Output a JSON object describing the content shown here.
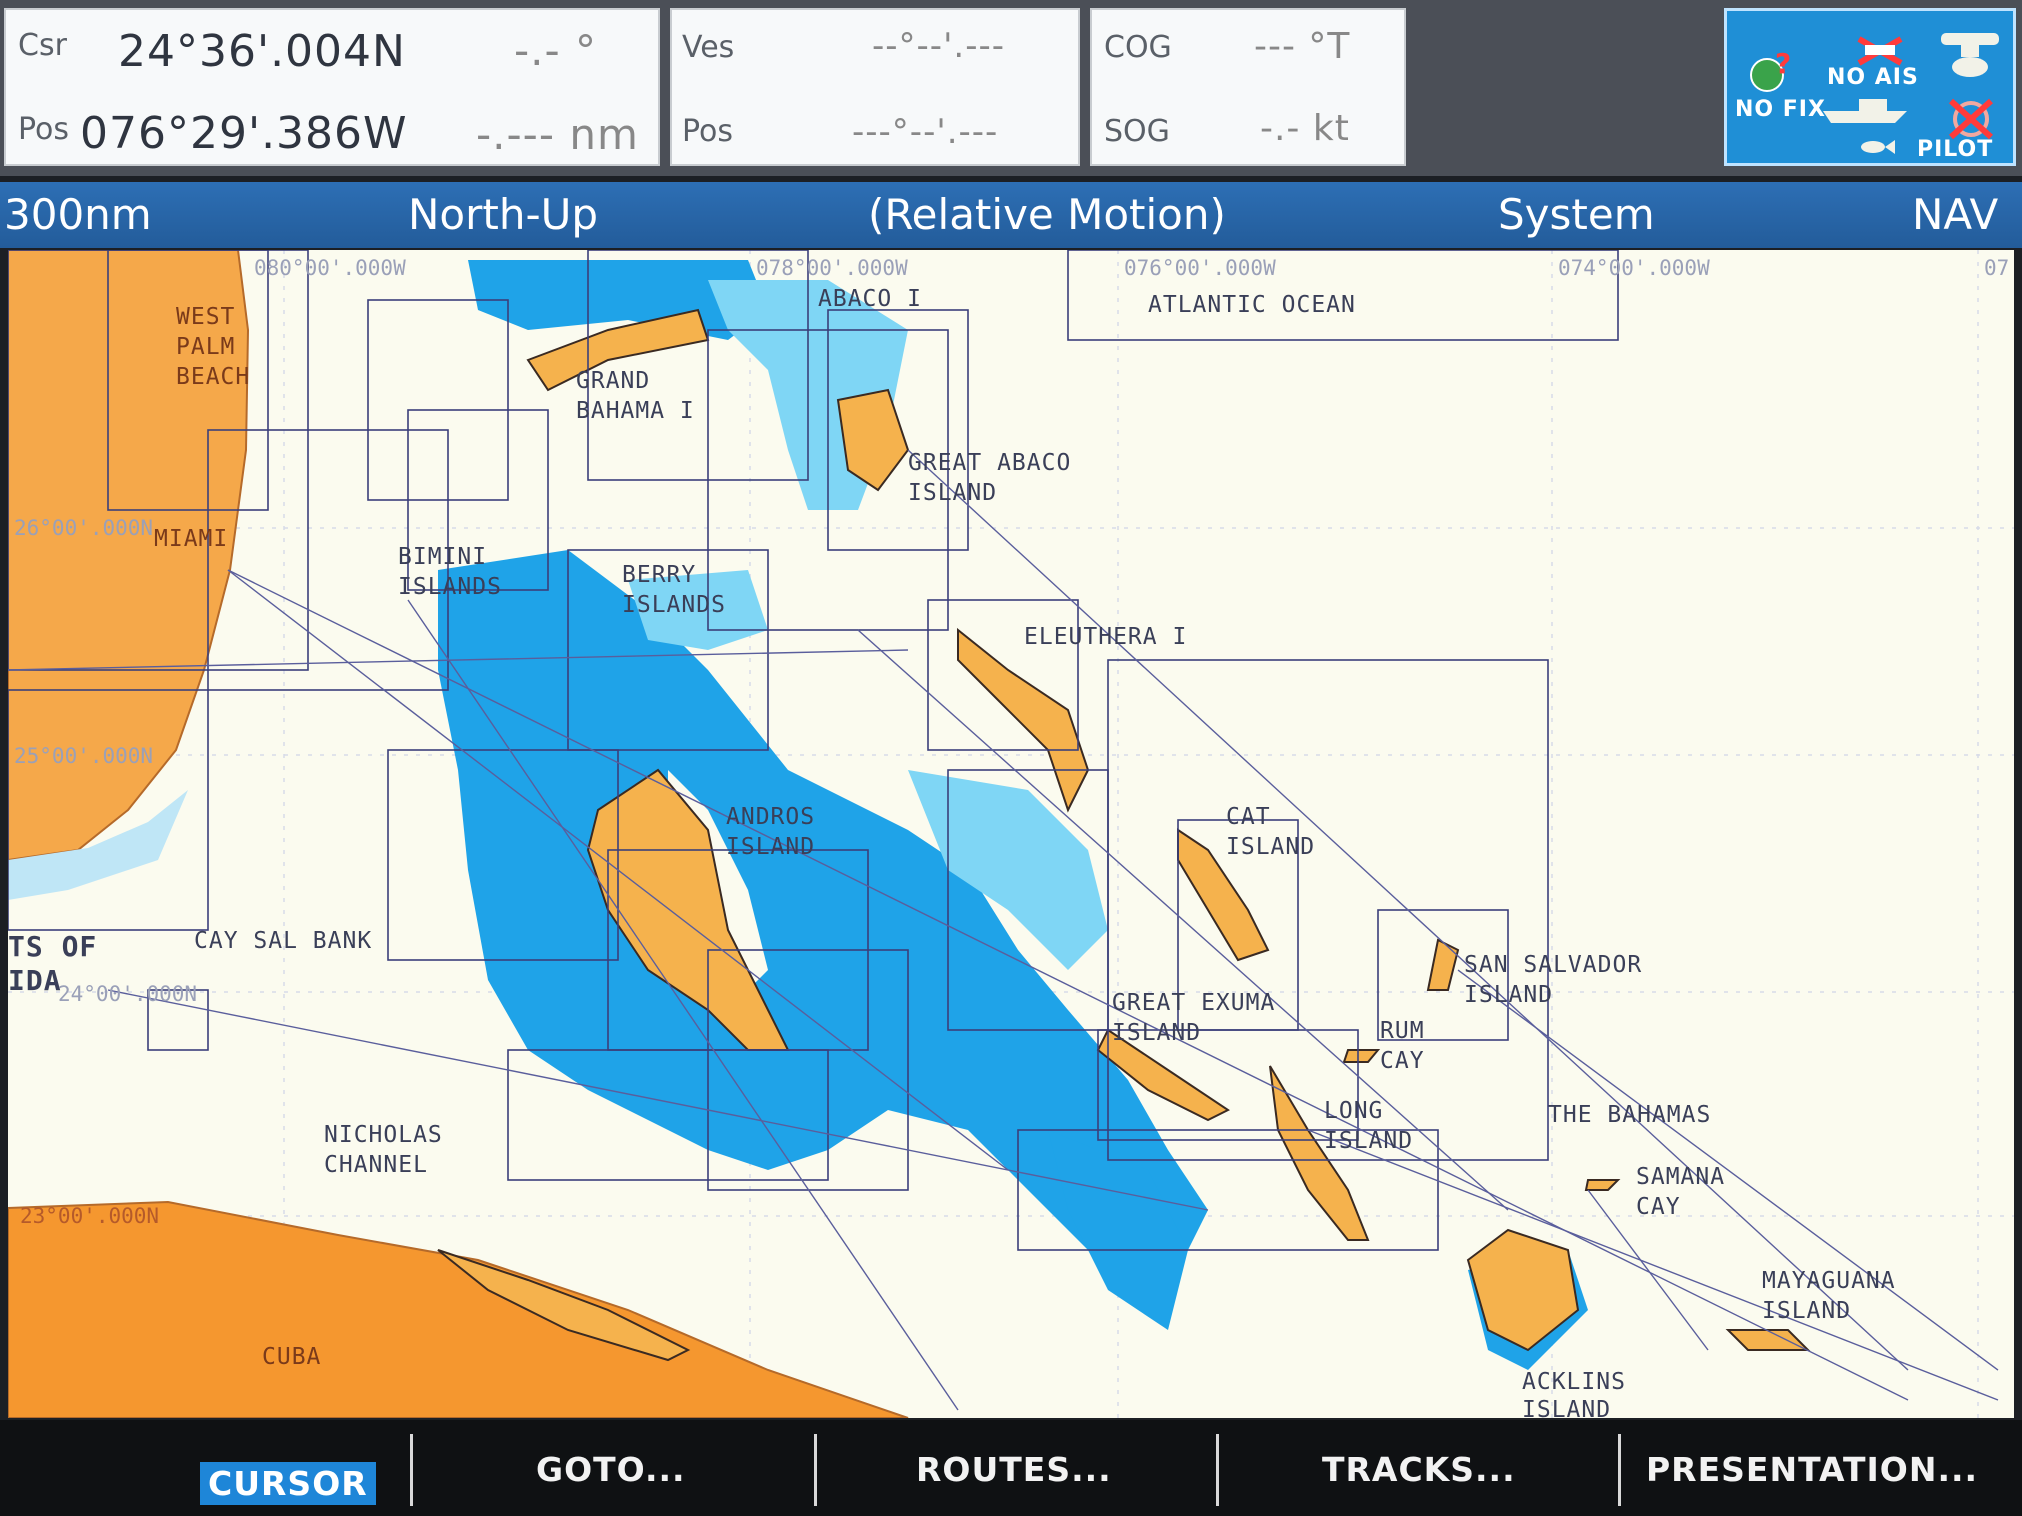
{
  "top": {
    "csr": {
      "label": "Csr",
      "lat": "24°36'.004N",
      "bearing": "-.- °"
    },
    "pos": {
      "label": "Pos",
      "lon": "076°29'.386W",
      "range": "-.--- nm"
    },
    "ves": {
      "label": "Ves",
      "lat": "--°--'.---"
    },
    "vpos": {
      "label": "Pos",
      "lon": "---°--'.---"
    },
    "cog": {
      "label": "COG",
      "value": "--- °T"
    },
    "sog": {
      "label": "SOG",
      "value": "-.- kt"
    }
  },
  "status_panel": {
    "no_ais": "NO AIS",
    "no_fix": "NO FIX",
    "pilot": "PILOT",
    "icons": [
      "satellite-icon",
      "ais-icon",
      "radar-icon",
      "boat-icon",
      "fish-icon",
      "autopilot-helm-icon"
    ]
  },
  "statusbar": {
    "range": "300nm",
    "orientation": "North-Up",
    "motion": "(Relative Motion)",
    "system": "System",
    "mode": "NAV"
  },
  "map": {
    "lon_labels": [
      "080°00'.000W",
      "078°00'.000W",
      "076°00'.000W",
      "074°00'.000W",
      "07"
    ],
    "lat_labels": [
      "26°00'.000N",
      "25°00'.000N",
      "24°00'.000N",
      "23°00'.000N"
    ],
    "labels": {
      "west_palm": "WEST\nPALM\nBEACH",
      "miami": "MIAMI",
      "abaco": "ABACO I",
      "atlantic": "ATLANTIC OCEAN",
      "grand_bahama": "GRAND\nBAHAMA I",
      "great_abaco": "GREAT ABACO\nISLAND",
      "bimini": "BIMINI\nISLANDS",
      "berry": "BERRY\nISLANDS",
      "eleuthera": "ELEUTHERA I",
      "andros": "ANDROS\nISLAND",
      "cat": "CAT\nISLAND",
      "straits": "TS OF\nIDA",
      "cay_sal": "CAY SAL BANK",
      "san_salvador": "SAN SALVADOR\nISLAND",
      "great_exuma": "GREAT EXUMA\nISLAND",
      "rum_cay": "RUM\nCAY",
      "long_island": "LONG\nISLAND",
      "the_bahamas": "THE BAHAMAS",
      "nicholas": "NICHOLAS\nCHANNEL",
      "samana": "SAMANA\nCAY",
      "mayaguana": "MAYAGUANA\nISLAND",
      "cuba": "CUBA",
      "acklins": "ACKLINS\nISLAND"
    }
  },
  "softkeys": [
    {
      "label": "CURSOR",
      "active": true
    },
    {
      "label": "GOTO...",
      "active": false
    },
    {
      "label": "ROUTES...",
      "active": false
    },
    {
      "label": "TRACKS...",
      "active": false
    },
    {
      "label": "PRESENTATION...",
      "active": false
    }
  ],
  "colors": {
    "land": "#f5b24d",
    "shallow": "#7fd6f5",
    "deep": "#1fa3e8",
    "sea": "#fbfbef",
    "accent": "#1e86d8"
  }
}
